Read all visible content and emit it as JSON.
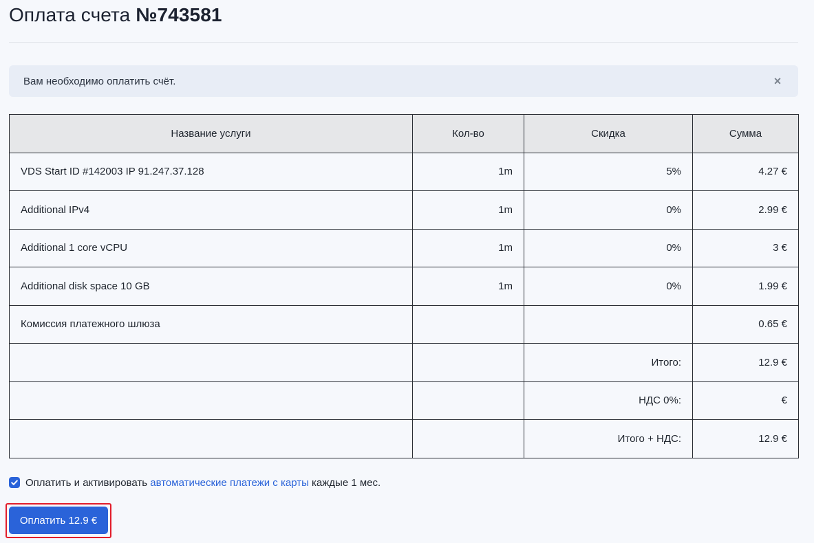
{
  "header": {
    "title_prefix": "Оплата счета ",
    "invoice_number": "№743581"
  },
  "alert": {
    "message": "Вам необходимо оплатить счёт.",
    "close_glyph": "×"
  },
  "table": {
    "columns": [
      "Название услуги",
      "Кол-во",
      "Скидка",
      "Сумма"
    ],
    "rows": [
      {
        "name": "VDS Start ID #142003 IP 91.247.37.128",
        "qty": "1m",
        "discount": "5%",
        "sum": "4.27 €"
      },
      {
        "name": "Additional IPv4",
        "qty": "1m",
        "discount": "0%",
        "sum": "2.99 €"
      },
      {
        "name": "Additional 1 core vCPU",
        "qty": "1m",
        "discount": "0%",
        "sum": "3 €"
      },
      {
        "name": "Additional disk space 10 GB",
        "qty": "1m",
        "discount": "0%",
        "sum": "1.99 €"
      },
      {
        "name": "Комиссия платежного шлюза",
        "qty": "",
        "discount": "",
        "sum": "0.65 €"
      }
    ],
    "totals": [
      {
        "label": "Итого:",
        "value": "12.9 €"
      },
      {
        "label": "НДС 0%:",
        "value": "€"
      },
      {
        "label": "Итого + НДС:",
        "value": "12.9 €"
      }
    ]
  },
  "autopay": {
    "checked": true,
    "text_before": "Оплатить и активировать ",
    "link_text": "автоматические платежи с карты",
    "text_after": " каждые 1 мес."
  },
  "pay_button": {
    "label": "Оплатить 12.9 €"
  },
  "colors": {
    "accent": "#2a63d9",
    "highlight": "#e21c2a",
    "alert_bg": "#e8edf6",
    "table_header_bg": "#e6e7e9"
  }
}
